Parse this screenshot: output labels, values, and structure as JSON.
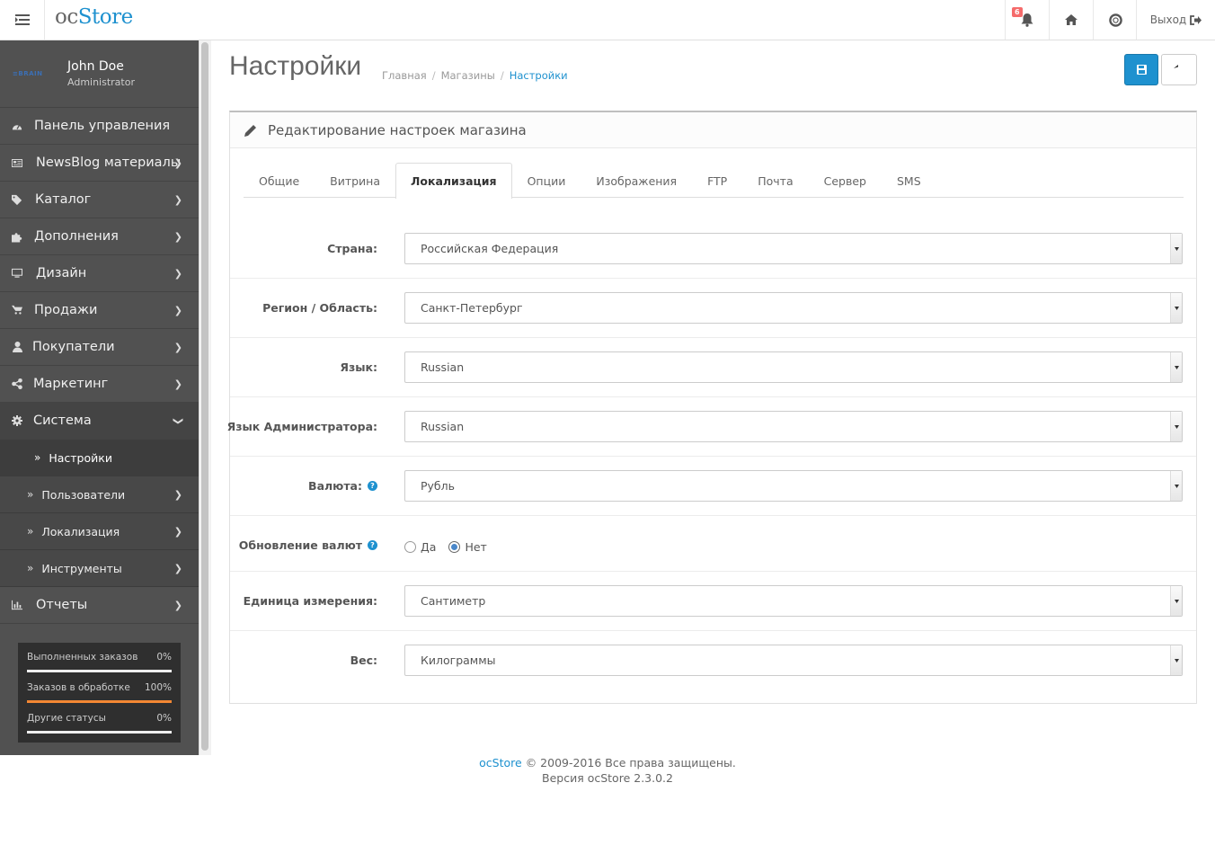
{
  "header": {
    "logo_oc": "oc",
    "logo_store": "Store",
    "notification_count": "6",
    "logout_label": "Выход"
  },
  "profile": {
    "logo_text": "≡BRAIN",
    "name": "John Doe",
    "role": "Administrator"
  },
  "sidebar": {
    "items": [
      {
        "label": "Панель управления",
        "icon": "dashboard-icon"
      },
      {
        "label": "NewsBlog материалы",
        "icon": "newspaper-icon"
      },
      {
        "label": "Каталог",
        "icon": "tags-icon"
      },
      {
        "label": "Дополнения",
        "icon": "puzzle-icon"
      },
      {
        "label": "Дизайн",
        "icon": "monitor-icon"
      },
      {
        "label": "Продажи",
        "icon": "cart-icon"
      },
      {
        "label": "Покупатели",
        "icon": "user-icon"
      },
      {
        "label": "Маркетинг",
        "icon": "share-icon"
      },
      {
        "label": "Система",
        "icon": "gear-icon"
      }
    ],
    "system_sub": [
      {
        "label": "Настройки"
      },
      {
        "label": "Пользователи"
      },
      {
        "label": "Локализация"
      },
      {
        "label": "Инструменты"
      }
    ],
    "reports": {
      "label": "Отчеты",
      "icon": "bar-chart-icon"
    }
  },
  "stats": [
    {
      "label": "Выполненных заказов",
      "value": "0%",
      "fraction": 0
    },
    {
      "label": "Заказов в обработке",
      "value": "100%",
      "fraction": 1
    },
    {
      "label": "Другие статусы",
      "value": "0%",
      "fraction": 0
    }
  ],
  "page": {
    "title": "Настройки",
    "breadcrumb": [
      "Главная",
      "Магазины",
      "Настройки"
    ]
  },
  "panel": {
    "title": "Редактирование настроек магазина",
    "tabs": [
      "Общие",
      "Витрина",
      "Локализация",
      "Опции",
      "Изображения",
      "FTP",
      "Почта",
      "Сервер",
      "SMS"
    ],
    "active_tab": "Локализация"
  },
  "form": {
    "country": {
      "label": "Страна:",
      "value": "Российская Федерация"
    },
    "region": {
      "label": "Регион / Область:",
      "value": "Санкт-Петербург"
    },
    "language": {
      "label": "Язык:",
      "value": "Russian"
    },
    "admin_language": {
      "label": "Язык Администратора:",
      "value": "Russian"
    },
    "currency": {
      "label": "Валюта:",
      "value": "Рубль"
    },
    "currency_auto": {
      "label": "Обновление валют",
      "options": [
        "Да",
        "Нет"
      ],
      "selected": "Нет"
    },
    "length": {
      "label": "Единица измерения:",
      "value": "Сантиметр"
    },
    "weight": {
      "label": "Вес:",
      "value": "Килограммы"
    }
  },
  "footer": {
    "brand": "ocStore",
    "copyright": "© 2009-2016 Все права защищены.",
    "version": "Версия ocStore 2.3.0.2"
  },
  "colors": {
    "accent": "#1e91cf",
    "sidebar": "#515151",
    "progress": "#f38733"
  }
}
